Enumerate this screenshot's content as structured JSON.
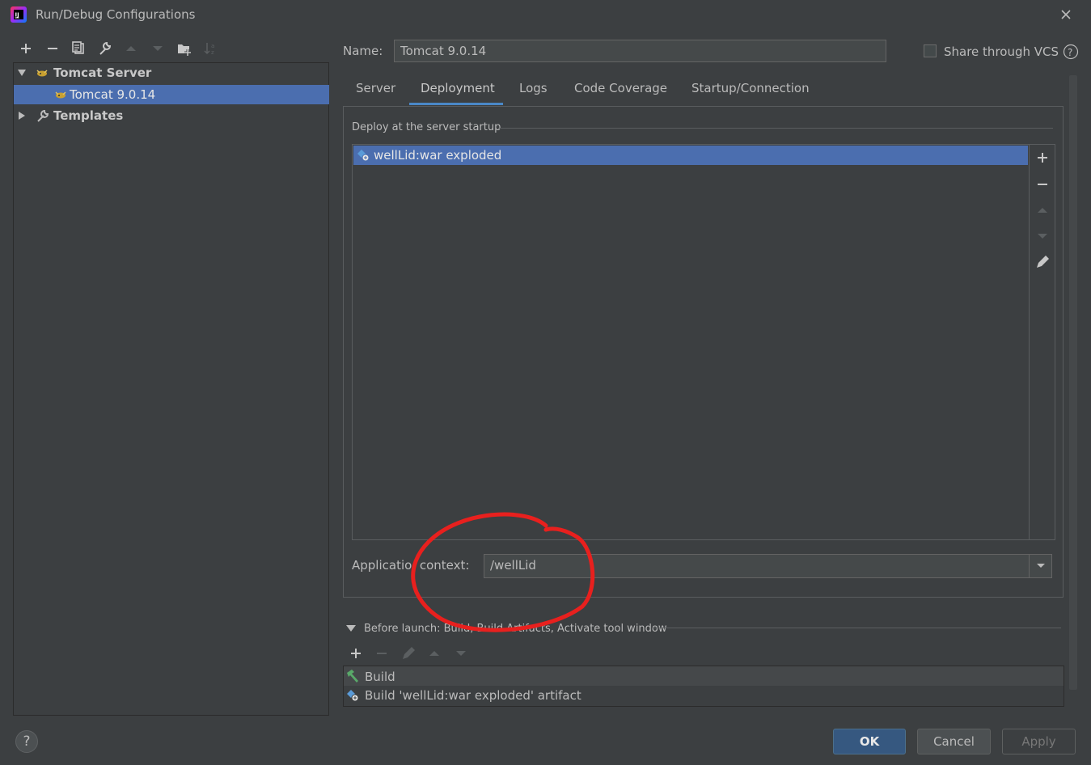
{
  "window": {
    "title": "Run/Debug Configurations"
  },
  "tree": {
    "group_label": "Tomcat Server",
    "selected_label": "Tomcat 9.0.14",
    "templates_label": "Templates"
  },
  "name": {
    "label": "Name:",
    "value": "Tomcat 9.0.14"
  },
  "share": {
    "label": "Share through VCS",
    "checked": false
  },
  "tabs": [
    {
      "label": "Server"
    },
    {
      "label": "Deployment",
      "active": true
    },
    {
      "label": "Logs"
    },
    {
      "label": "Code Coverage"
    },
    {
      "label": "Startup/Connection"
    }
  ],
  "deploy": {
    "section_title": "Deploy at the server startup",
    "items": [
      {
        "label": "wellLid:war exploded",
        "selected": true
      }
    ],
    "app_context_label": "Applicatio  context:",
    "app_context_value": "/wellLid"
  },
  "before_launch": {
    "title": "Before launch: Build, Build Artifacts, Activate tool window",
    "items": [
      {
        "label": "Build"
      },
      {
        "label": "Build 'wellLid:war exploded' artifact"
      }
    ]
  },
  "buttons": {
    "ok": "OK",
    "cancel": "Cancel",
    "apply": "Apply",
    "help": "?"
  },
  "colors": {
    "accent": "#4a88c7",
    "selection": "#4b6eaf",
    "annotation": "#e8201e"
  }
}
